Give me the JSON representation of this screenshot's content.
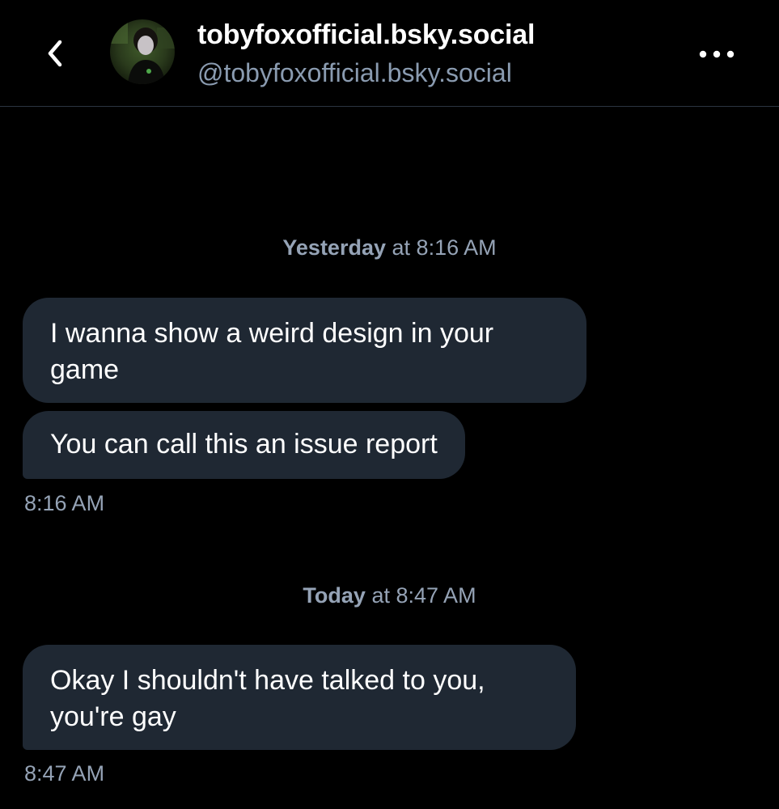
{
  "header": {
    "back_icon": "chevron-left-icon",
    "display_name": "tobyfoxofficial.bsky.social",
    "handle": "@tobyfoxofficial.bsky.social",
    "more_icon": "more-horizontal-icon"
  },
  "conversation": {
    "groups": [
      {
        "day": "Yesterday",
        "connector": "at",
        "time": "8:16 AM",
        "messages": [
          "I wanna show a weird design in your game",
          "You can call this an issue report"
        ],
        "sent_time": "8:16 AM"
      },
      {
        "day": "Today",
        "connector": "at",
        "time": "8:47 AM",
        "messages": [
          "Okay I shouldn't have talked to you, you're gay"
        ],
        "sent_time": "8:47 AM"
      }
    ]
  },
  "colors": {
    "background": "#000000",
    "bubble": "#1f2833",
    "muted_text": "#95a3b6",
    "handle_text": "#8a9bb0",
    "divider": "#2b3440"
  }
}
